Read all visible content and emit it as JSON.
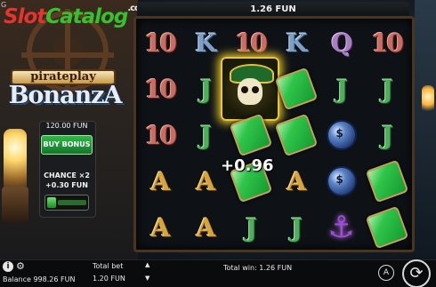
{
  "watermark": {
    "part1": "Slot",
    "part2": "Catalog",
    "part3": ".com"
  },
  "corner_glyph": "G",
  "logo": {
    "top_line": "pirateplay",
    "main_line": "BonanzA"
  },
  "bonus_panel": {
    "price": "120.00 FUN",
    "buy_label": "BUY BONUS",
    "chance_line1": "CHANCE ×2",
    "chance_line2": "+0.30 FUN",
    "chance_toggle_on": true
  },
  "bet_display": "1.26 FUN",
  "win_popup": "+0.96",
  "grid": {
    "rows": [
      [
        "10",
        "K",
        "10",
        "K",
        "Q",
        "10"
      ],
      [
        "10",
        "J",
        "skull",
        "map",
        "J",
        "J"
      ],
      [
        "10",
        "J",
        "map",
        "map",
        "bomb",
        "J"
      ],
      [
        "A",
        "A",
        "map",
        "A",
        "bomb",
        "map"
      ],
      [
        "A",
        "A",
        "J",
        "J",
        "anchor",
        "map"
      ]
    ]
  },
  "bottom": {
    "info_label": "i",
    "gear_icon": "⚙",
    "balance": "Balance 998.26 FUN",
    "total_bet_label": "Total bet",
    "total_bet_value": "1.20 FUN",
    "total_win": "Total win: 1.26 FUN",
    "auto_label": "A",
    "spin_glyph": "⟳",
    "arrow_up": "▲",
    "arrow_down": "▼"
  }
}
